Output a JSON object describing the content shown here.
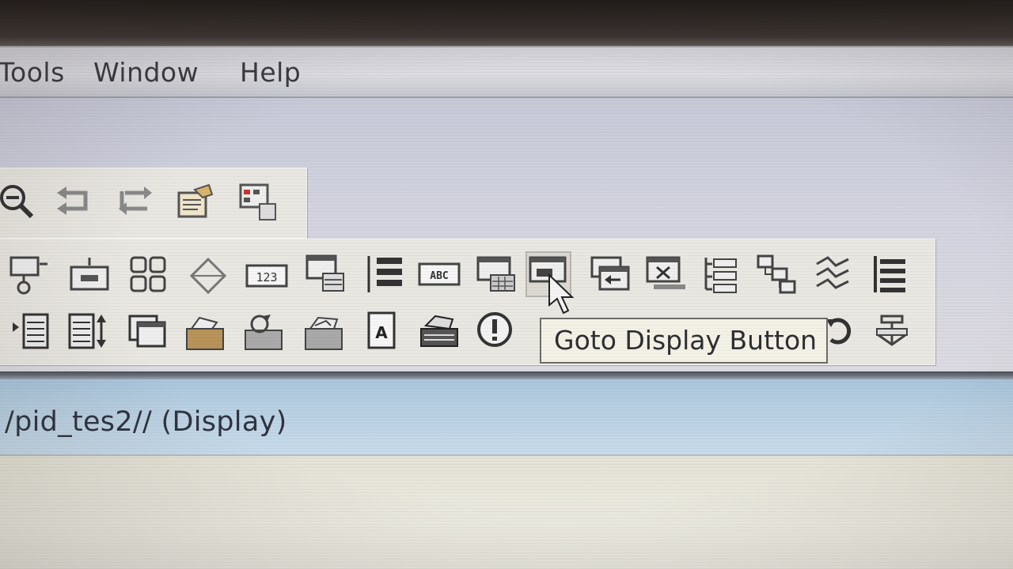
{
  "menu": {
    "items": [
      {
        "label": "Tools"
      },
      {
        "label": "Window"
      },
      {
        "label": "Help"
      }
    ]
  },
  "toolbar_small": {
    "icons": [
      "zoom-out-icon",
      "undo-arrow-icon",
      "swap-arrows-icon",
      "properties-icon",
      "grid-layout-icon"
    ]
  },
  "toolbar_main": {
    "row1": [
      "connect-node-icon",
      "button-control-icon",
      "group-objects-icon",
      "diamond-shape-icon",
      "numeric-display-icon",
      "trend-window-icon",
      "list-control-icon",
      "text-abc-icon",
      "table-window-icon",
      "goto-display-button-icon",
      "window-arrow-icon",
      "window-close-icon",
      "tree-list-icon",
      "hierarchy-icon",
      "scatter-graph-icon",
      "column-list-icon"
    ],
    "row2": [
      "indent-list-icon",
      "sort-list-icon",
      "window-copy-icon",
      "folder-open-icon",
      "refresh-folder-icon",
      "folder-image-icon",
      "document-icon",
      "printer-icon",
      "info-circle-icon",
      "hidden-icon",
      "hidden-icon",
      "hidden-icon",
      "hidden-icon",
      "hidden-icon",
      "spinner-icon",
      "anchor-icon"
    ]
  },
  "tooltip": {
    "text": "Goto Display Button"
  },
  "window": {
    "title": "/pid_tes2// (Display)"
  }
}
